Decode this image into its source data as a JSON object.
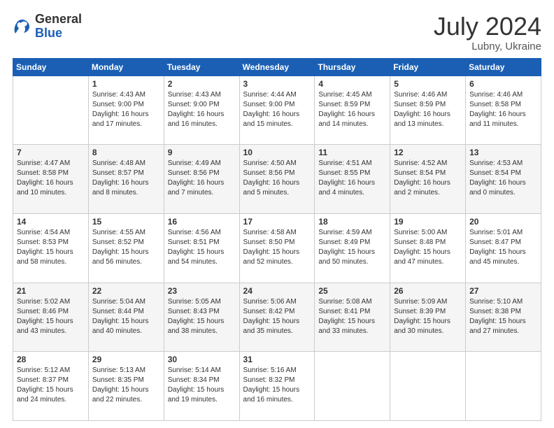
{
  "header": {
    "logo_general": "General",
    "logo_blue": "Blue",
    "month_year": "July 2024",
    "location": "Lubny, Ukraine"
  },
  "days_of_week": [
    "Sunday",
    "Monday",
    "Tuesday",
    "Wednesday",
    "Thursday",
    "Friday",
    "Saturday"
  ],
  "weeks": [
    [
      {
        "day": "",
        "info": ""
      },
      {
        "day": "1",
        "info": "Sunrise: 4:43 AM\nSunset: 9:00 PM\nDaylight: 16 hours\nand 17 minutes."
      },
      {
        "day": "2",
        "info": "Sunrise: 4:43 AM\nSunset: 9:00 PM\nDaylight: 16 hours\nand 16 minutes."
      },
      {
        "day": "3",
        "info": "Sunrise: 4:44 AM\nSunset: 9:00 PM\nDaylight: 16 hours\nand 15 minutes."
      },
      {
        "day": "4",
        "info": "Sunrise: 4:45 AM\nSunset: 8:59 PM\nDaylight: 16 hours\nand 14 minutes."
      },
      {
        "day": "5",
        "info": "Sunrise: 4:46 AM\nSunset: 8:59 PM\nDaylight: 16 hours\nand 13 minutes."
      },
      {
        "day": "6",
        "info": "Sunrise: 4:46 AM\nSunset: 8:58 PM\nDaylight: 16 hours\nand 11 minutes."
      }
    ],
    [
      {
        "day": "7",
        "info": "Sunrise: 4:47 AM\nSunset: 8:58 PM\nDaylight: 16 hours\nand 10 minutes."
      },
      {
        "day": "8",
        "info": "Sunrise: 4:48 AM\nSunset: 8:57 PM\nDaylight: 16 hours\nand 8 minutes."
      },
      {
        "day": "9",
        "info": "Sunrise: 4:49 AM\nSunset: 8:56 PM\nDaylight: 16 hours\nand 7 minutes."
      },
      {
        "day": "10",
        "info": "Sunrise: 4:50 AM\nSunset: 8:56 PM\nDaylight: 16 hours\nand 5 minutes."
      },
      {
        "day": "11",
        "info": "Sunrise: 4:51 AM\nSunset: 8:55 PM\nDaylight: 16 hours\nand 4 minutes."
      },
      {
        "day": "12",
        "info": "Sunrise: 4:52 AM\nSunset: 8:54 PM\nDaylight: 16 hours\nand 2 minutes."
      },
      {
        "day": "13",
        "info": "Sunrise: 4:53 AM\nSunset: 8:54 PM\nDaylight: 16 hours\nand 0 minutes."
      }
    ],
    [
      {
        "day": "14",
        "info": "Sunrise: 4:54 AM\nSunset: 8:53 PM\nDaylight: 15 hours\nand 58 minutes."
      },
      {
        "day": "15",
        "info": "Sunrise: 4:55 AM\nSunset: 8:52 PM\nDaylight: 15 hours\nand 56 minutes."
      },
      {
        "day": "16",
        "info": "Sunrise: 4:56 AM\nSunset: 8:51 PM\nDaylight: 15 hours\nand 54 minutes."
      },
      {
        "day": "17",
        "info": "Sunrise: 4:58 AM\nSunset: 8:50 PM\nDaylight: 15 hours\nand 52 minutes."
      },
      {
        "day": "18",
        "info": "Sunrise: 4:59 AM\nSunset: 8:49 PM\nDaylight: 15 hours\nand 50 minutes."
      },
      {
        "day": "19",
        "info": "Sunrise: 5:00 AM\nSunset: 8:48 PM\nDaylight: 15 hours\nand 47 minutes."
      },
      {
        "day": "20",
        "info": "Sunrise: 5:01 AM\nSunset: 8:47 PM\nDaylight: 15 hours\nand 45 minutes."
      }
    ],
    [
      {
        "day": "21",
        "info": "Sunrise: 5:02 AM\nSunset: 8:46 PM\nDaylight: 15 hours\nand 43 minutes."
      },
      {
        "day": "22",
        "info": "Sunrise: 5:04 AM\nSunset: 8:44 PM\nDaylight: 15 hours\nand 40 minutes."
      },
      {
        "day": "23",
        "info": "Sunrise: 5:05 AM\nSunset: 8:43 PM\nDaylight: 15 hours\nand 38 minutes."
      },
      {
        "day": "24",
        "info": "Sunrise: 5:06 AM\nSunset: 8:42 PM\nDaylight: 15 hours\nand 35 minutes."
      },
      {
        "day": "25",
        "info": "Sunrise: 5:08 AM\nSunset: 8:41 PM\nDaylight: 15 hours\nand 33 minutes."
      },
      {
        "day": "26",
        "info": "Sunrise: 5:09 AM\nSunset: 8:39 PM\nDaylight: 15 hours\nand 30 minutes."
      },
      {
        "day": "27",
        "info": "Sunrise: 5:10 AM\nSunset: 8:38 PM\nDaylight: 15 hours\nand 27 minutes."
      }
    ],
    [
      {
        "day": "28",
        "info": "Sunrise: 5:12 AM\nSunset: 8:37 PM\nDaylight: 15 hours\nand 24 minutes."
      },
      {
        "day": "29",
        "info": "Sunrise: 5:13 AM\nSunset: 8:35 PM\nDaylight: 15 hours\nand 22 minutes."
      },
      {
        "day": "30",
        "info": "Sunrise: 5:14 AM\nSunset: 8:34 PM\nDaylight: 15 hours\nand 19 minutes."
      },
      {
        "day": "31",
        "info": "Sunrise: 5:16 AM\nSunset: 8:32 PM\nDaylight: 15 hours\nand 16 minutes."
      },
      {
        "day": "",
        "info": ""
      },
      {
        "day": "",
        "info": ""
      },
      {
        "day": "",
        "info": ""
      }
    ]
  ]
}
